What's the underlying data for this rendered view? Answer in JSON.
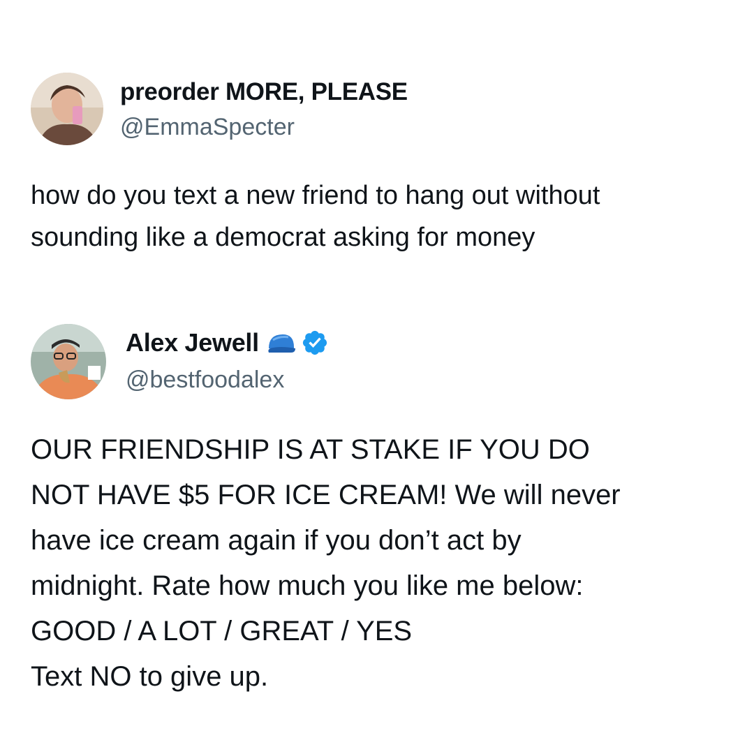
{
  "tweets": [
    {
      "display_name": "preorder MORE, PLEASE",
      "handle": "@EmmaSpecter",
      "text": "how do you text a new friend to hang out without\nsounding like a democrat asking for money"
    },
    {
      "display_name": "Alex Jewell",
      "handle": "@bestfoodalex",
      "name_icons": [
        "cap-icon",
        "verified-badge-icon"
      ],
      "text": "OUR FRIENDSHIP IS AT STAKE IF YOU DO\nNOT HAVE $5 FOR ICE CREAM! We will never\nhave ice cream again if you don’t act by\nmidnight. Rate how much you like me below:\nGOOD / A LOT / GREAT / YES\nText NO to give up."
    }
  ],
  "colors": {
    "text": "#0f1419",
    "handle": "#536471",
    "verified": "#1d9bf0",
    "cap": "#2f7fd6"
  }
}
